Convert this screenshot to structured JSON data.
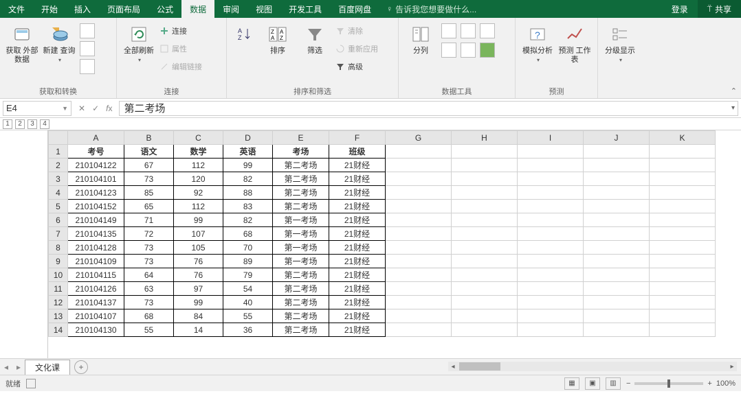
{
  "tabs": [
    "文件",
    "开始",
    "插入",
    "页面布局",
    "公式",
    "数据",
    "审阅",
    "视图",
    "开发工具",
    "百度网盘"
  ],
  "active_tab": "数据",
  "tell_me": "告诉我您想要做什么...",
  "login": "登录",
  "share": "共享",
  "ribbon": {
    "g1": {
      "label": "获取和转换",
      "ext": "获取\n外部数据",
      "newq": "新建\n查询"
    },
    "g2": {
      "label": "连接",
      "refresh": "全部刷新",
      "conn": "连接",
      "prop": "属性",
      "edit": "编辑链接"
    },
    "g3": {
      "label": "排序和筛选",
      "sort": "排序",
      "filter": "筛选",
      "clear": "清除",
      "reapply": "重新应用",
      "adv": "高级"
    },
    "g4": {
      "label": "数据工具",
      "split": "分列"
    },
    "g5": {
      "label": "预测",
      "whatif": "模拟分析",
      "forecast": "预测\n工作表"
    },
    "g6": {
      "label": "",
      "outline": "分级显示"
    }
  },
  "namebox": "E4",
  "formula": "第二考场",
  "outline_levels": [
    "1",
    "2",
    "3",
    "4"
  ],
  "columns": [
    "A",
    "B",
    "C",
    "D",
    "E",
    "F",
    "G",
    "H",
    "I",
    "J",
    "K"
  ],
  "headers": [
    "考号",
    "语文",
    "数学",
    "英语",
    "考场",
    "班级"
  ],
  "rows": [
    [
      "210104122",
      "67",
      "112",
      "99",
      "第二考场",
      "21财经"
    ],
    [
      "210104101",
      "73",
      "120",
      "82",
      "第二考场",
      "21财经"
    ],
    [
      "210104123",
      "85",
      "92",
      "88",
      "第二考场",
      "21财经"
    ],
    [
      "210104152",
      "65",
      "112",
      "83",
      "第二考场",
      "21财经"
    ],
    [
      "210104149",
      "71",
      "99",
      "82",
      "第一考场",
      "21财经"
    ],
    [
      "210104135",
      "72",
      "107",
      "68",
      "第一考场",
      "21财经"
    ],
    [
      "210104128",
      "73",
      "105",
      "70",
      "第一考场",
      "21财经"
    ],
    [
      "210104109",
      "73",
      "76",
      "89",
      "第一考场",
      "21财经"
    ],
    [
      "210104115",
      "64",
      "76",
      "79",
      "第二考场",
      "21财经"
    ],
    [
      "210104126",
      "63",
      "97",
      "54",
      "第二考场",
      "21财经"
    ],
    [
      "210104137",
      "73",
      "99",
      "40",
      "第二考场",
      "21财经"
    ],
    [
      "210104107",
      "68",
      "84",
      "55",
      "第二考场",
      "21财经"
    ],
    [
      "210104130",
      "55",
      "14",
      "36",
      "第二考场",
      "21财经"
    ]
  ],
  "sheet": "文化课",
  "status": "就绪",
  "zoom": "100%"
}
